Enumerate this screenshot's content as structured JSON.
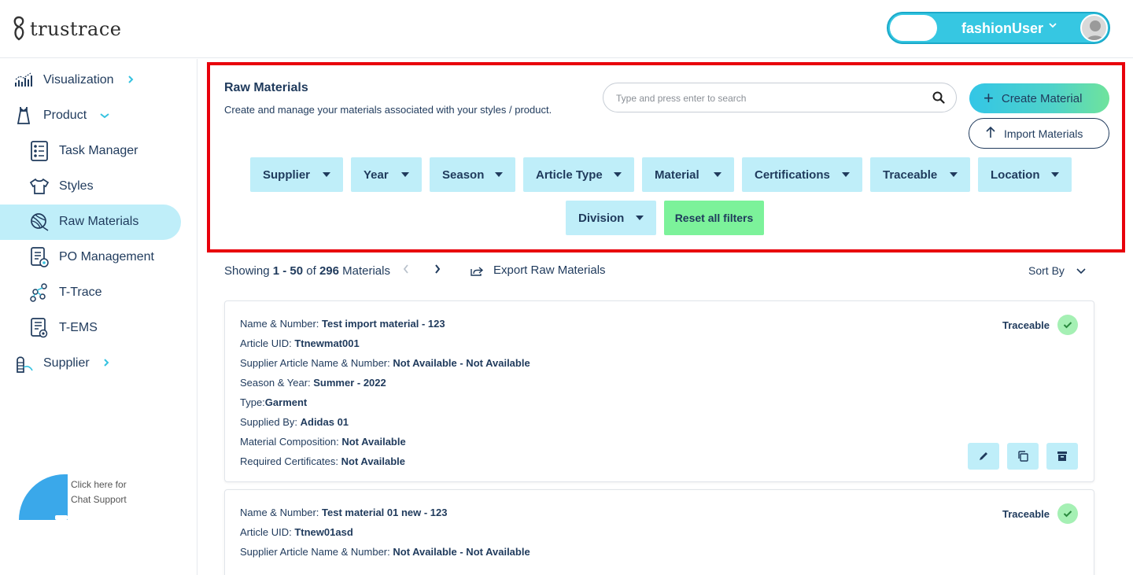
{
  "header": {
    "logo_text": "trustrace",
    "user_name": "fashionUser"
  },
  "sidebar": {
    "items": [
      {
        "label": "Visualization"
      },
      {
        "label": "Product"
      },
      {
        "label": "Task Manager"
      },
      {
        "label": "Styles"
      },
      {
        "label": "Raw Materials"
      },
      {
        "label": "PO Management"
      },
      {
        "label": "T-Trace"
      },
      {
        "label": "T-EMS"
      },
      {
        "label": "Supplier"
      }
    ],
    "active": "Raw Materials",
    "chat": {
      "line1": "Click here for",
      "line2": "Chat Support"
    }
  },
  "main": {
    "title": "Raw Materials",
    "subtitle": "Create and manage your materials associated with your styles / product.",
    "search_placeholder": "Type and press enter to search",
    "create_label": "Create Material",
    "import_label": "Import Materials",
    "filters": [
      "Supplier",
      "Year",
      "Season",
      "Article Type",
      "Material",
      "Certifications",
      "Traceable",
      "Location",
      "Division"
    ],
    "reset_label": "Reset all filters",
    "results": {
      "prefix": "Showing ",
      "range": "1 - 50",
      "of": " of ",
      "total": "296",
      "suffix": " Materials",
      "export_label": "Export Raw Materials",
      "sort_label": "Sort By"
    },
    "cards": [
      {
        "name_label": "Name & Number: ",
        "name_value": "Test import material - 123",
        "uid_label": "Article UID: ",
        "uid_value": "Ttnewmat001",
        "supplier_article_label": "Supplier Article Name & Number: ",
        "supplier_article_value": "Not Available - Not Available",
        "season_label": "Season & Year: ",
        "season_value": "Summer - 2022",
        "type_label": "Type:",
        "type_value": "Garment",
        "supplied_label": "Supplied By: ",
        "supplied_value": "Adidas 01",
        "composition_label": "Material Composition: ",
        "composition_value": "Not Available",
        "certs_label": "Required Certificates: ",
        "certs_value": "Not Available",
        "status": "Traceable"
      },
      {
        "name_label": "Name & Number: ",
        "name_value": "Test material 01 new - 123",
        "uid_label": "Article UID: ",
        "uid_value": "Ttnew01asd",
        "supplier_article_label": "Supplier Article Name & Number: ",
        "supplier_article_value": "Not Available - Not Available",
        "status": "Traceable"
      }
    ]
  },
  "colors": {
    "brand_cyan": "#36c7e2",
    "filter_bg": "#bfeef9",
    "reset_green": "#7cf29a",
    "highlight_red": "#e8000b",
    "text_navy": "#1f3a5c",
    "traceable_tick": "#a5f0b4"
  }
}
